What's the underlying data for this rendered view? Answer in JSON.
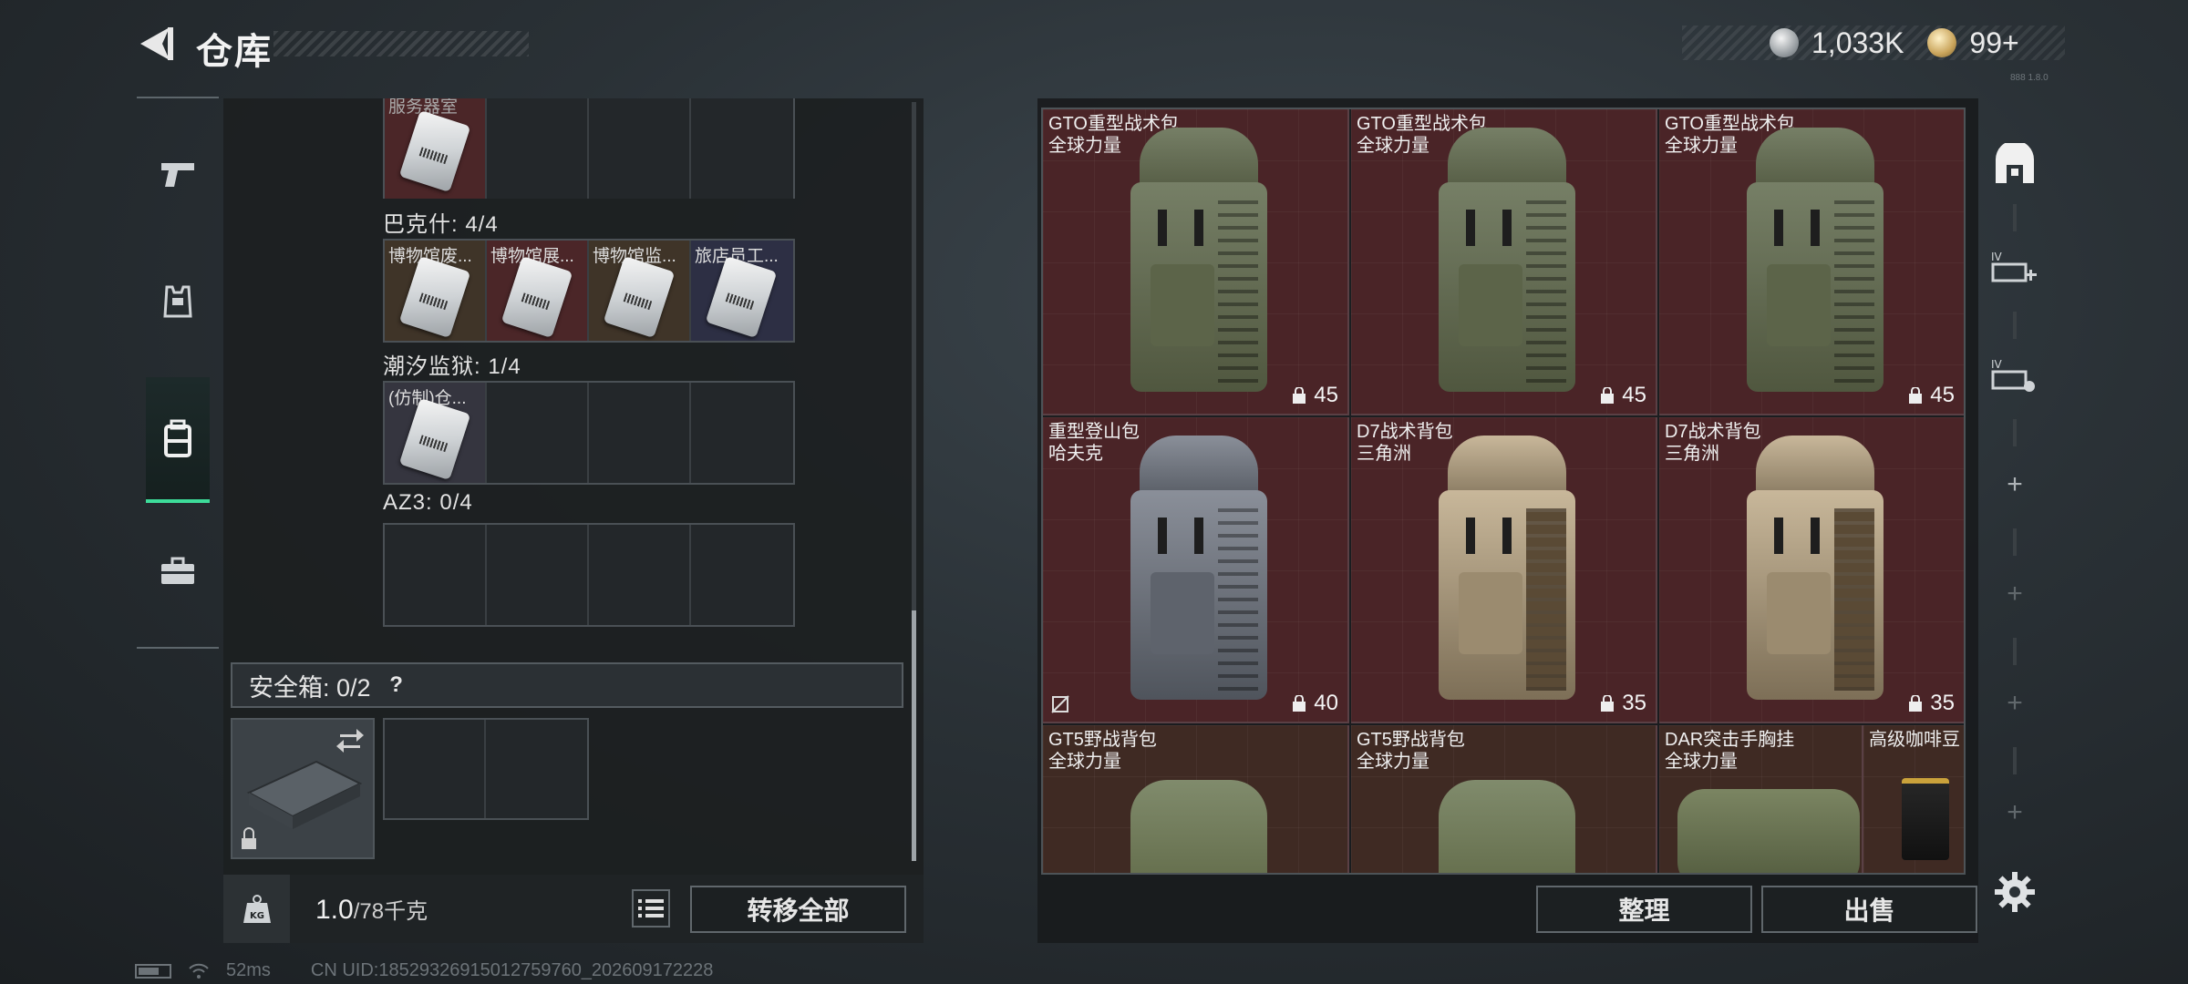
{
  "header": {
    "title": "仓库",
    "currency_silver": "1,033K",
    "currency_gold": "99+",
    "version_note": "888 1.8.0"
  },
  "nav": {
    "items": [
      {
        "icon": "pistol-icon",
        "active": false
      },
      {
        "icon": "armor-vest-icon",
        "active": false
      },
      {
        "icon": "backpack-icon",
        "active": true
      },
      {
        "icon": "toolbox-icon",
        "active": false
      }
    ]
  },
  "key_groups": {
    "top_partial_label": "服务器室",
    "group1": {
      "label": "巴克什: 4/4",
      "slots": [
        "博物馆废...",
        "博物馆展...",
        "博物馆监...",
        "旅店员工..."
      ]
    },
    "group2": {
      "label": "潮汐监狱: 1/4",
      "slots": [
        "(仿制)仓..."
      ]
    },
    "group3": {
      "label": "AZ3: 0/4",
      "slots": []
    }
  },
  "secure_box": {
    "label": "安全箱: 0/2",
    "help": "?"
  },
  "weight": {
    "current": "1.0",
    "max": "/78千克",
    "kg_label": "KG"
  },
  "buttons": {
    "transfer_all": "转移全部",
    "sort": "整理",
    "sell": "出售"
  },
  "items": [
    {
      "name": "GTO重型战术包",
      "brand": "全球力量",
      "capacity": "45",
      "style": "green"
    },
    {
      "name": "GTO重型战术包",
      "brand": "全球力量",
      "capacity": "45",
      "style": "green"
    },
    {
      "name": "GTO重型战术包",
      "brand": "全球力量",
      "capacity": "45",
      "style": "green"
    },
    {
      "name": "重型登山包",
      "brand": "哈夫克",
      "capacity": "40",
      "style": "gray"
    },
    {
      "name": "D7战术背包",
      "brand": "三角洲",
      "capacity": "35",
      "style": "tan"
    },
    {
      "name": "D7战术背包",
      "brand": "三角洲",
      "capacity": "35",
      "style": "tan"
    },
    {
      "name": "GT5野战背包",
      "brand": "全球力量",
      "capacity": "",
      "style": "rucksack"
    },
    {
      "name": "GT5野战背包",
      "brand": "全球力量",
      "capacity": "",
      "style": "rucksack"
    },
    {
      "name": "DAR突击手胸挂",
      "brand": "全球力量",
      "capacity": "",
      "style": "chestrig"
    },
    {
      "name": "高级咖啡豆",
      "brand": "",
      "capacity": "",
      "style": "coffee"
    }
  ],
  "right_sidebar": {
    "tier_label": "IV"
  },
  "status": {
    "ping": "52ms",
    "uid": "CN UID:18529326915012759760_202609172228"
  },
  "colors": {
    "accent_green": "#3ddc9a",
    "item_bg_red": "#4a2427",
    "item_bg_brown": "#3f2a23"
  }
}
